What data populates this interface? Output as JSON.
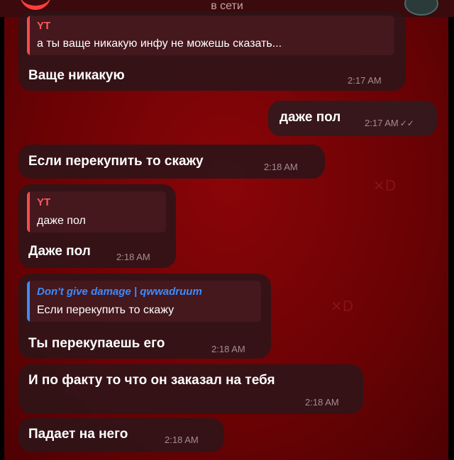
{
  "header": {
    "status": "в сети"
  },
  "messages": [
    {
      "id": "m1",
      "reply": {
        "name": "YT",
        "text": "а ты ваще никакую инфу не можешь сказать..."
      },
      "text": "Ваще никакую",
      "time": "2:17 AM"
    },
    {
      "id": "m2",
      "outgoing": true,
      "text": "даже пол",
      "time": "2:17 AM",
      "ticks": "✓✓"
    },
    {
      "id": "m3",
      "text": "Если перекупить то скажу",
      "time": "2:18 AM"
    },
    {
      "id": "m4",
      "reply": {
        "name": "YT",
        "text": "даже пол"
      },
      "text": "Даже пол",
      "time": "2:18 AM"
    },
    {
      "id": "m5",
      "reply": {
        "name": "Don't give damage | qwwadruum",
        "text": "Если перекупить то скажу"
      },
      "text": "Ты перекупаешь его",
      "time": "2:18 AM"
    },
    {
      "id": "m6",
      "text": "И по факту то что он заказал на тебя",
      "time": "2:18 AM"
    },
    {
      "id": "m7",
      "text": "Падает на него",
      "time": "2:18 AM"
    }
  ],
  "colors": {
    "accent_red": "#ff4a4a",
    "accent_blue": "#3d8bff",
    "bubble": "#301418"
  }
}
